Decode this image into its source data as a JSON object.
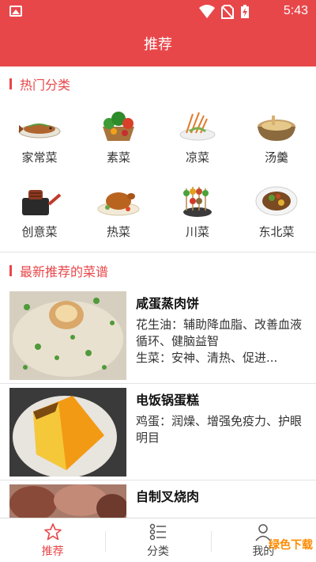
{
  "status": {
    "time": "5:43"
  },
  "header": {
    "title": "推荐"
  },
  "hot": {
    "title": "热门分类",
    "items": [
      {
        "label": "家常菜",
        "icon": "fish-dish-icon"
      },
      {
        "label": "素菜",
        "icon": "vegetable-basket-icon"
      },
      {
        "label": "凉菜",
        "icon": "cold-dish-icon"
      },
      {
        "label": "汤羹",
        "icon": "soup-pot-icon"
      },
      {
        "label": "创意菜",
        "icon": "grill-pan-icon"
      },
      {
        "label": "热菜",
        "icon": "roast-chicken-icon"
      },
      {
        "label": "川菜",
        "icon": "skewers-icon"
      },
      {
        "label": "东北菜",
        "icon": "stew-plate-icon"
      }
    ]
  },
  "latest": {
    "title": "最新推荐的菜谱",
    "items": [
      {
        "name": "咸蛋蒸肉饼",
        "desc": "花生油：辅助降血脂、改善血液循环、健脑益智\n生菜：安神、清热、促进..."
      },
      {
        "name": "电饭锅蛋糕",
        "desc": "鸡蛋：润燥、增强免疫力、护眼明目"
      },
      {
        "name": "自制叉烧肉",
        "desc": ""
      }
    ]
  },
  "nav": [
    {
      "label": "推荐",
      "icon": "star-icon"
    },
    {
      "label": "分类",
      "icon": "list-icon"
    },
    {
      "label": "我的",
      "icon": "person-icon"
    }
  ],
  "watermark": "绿色下载",
  "colors": {
    "accent": "#e8474a"
  }
}
